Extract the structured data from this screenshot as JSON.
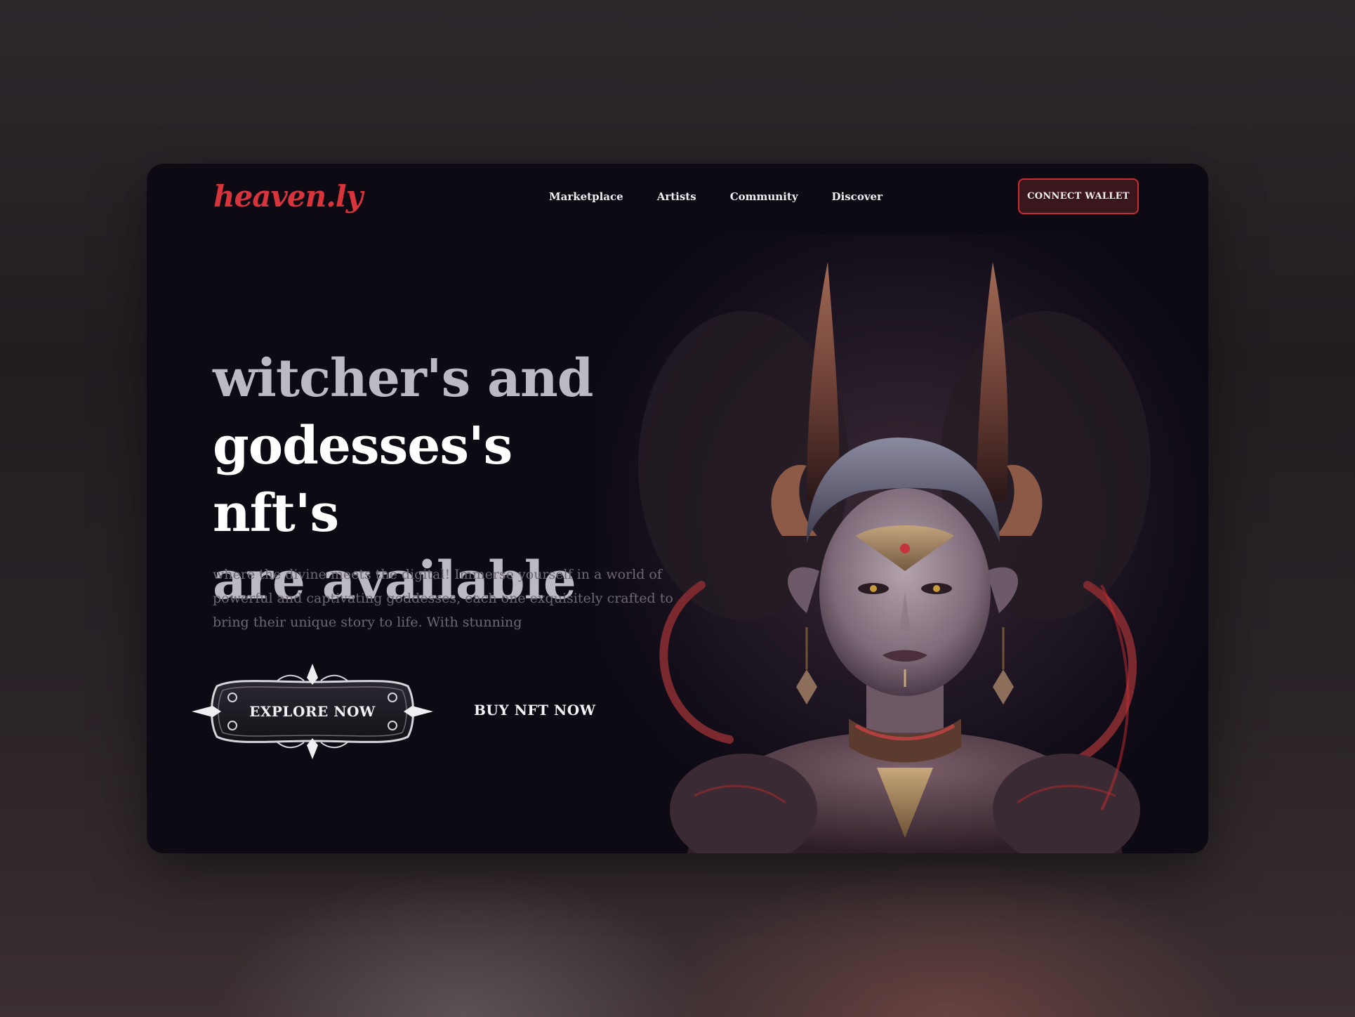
{
  "brand": {
    "logo": "heaven.ly",
    "accent": "#d8343c"
  },
  "nav": {
    "items": [
      {
        "label": "Marketplace"
      },
      {
        "label": "Artists"
      },
      {
        "label": "Community"
      },
      {
        "label": "Discover"
      }
    ]
  },
  "header": {
    "connect_label": "CONNECT WALLET"
  },
  "hero": {
    "headline": [
      "witcher's  and",
      "godesses's  nft's",
      "are  available"
    ],
    "description": "where the divine meets the digital! Immerse yourself in a world of powerful and captivating goddesses, each one exquisitely crafted to bring their unique story to life. With stunning",
    "primary_cta": "EXPLORE NOW",
    "secondary_cta": "BUY NFT NOW"
  },
  "colors": {
    "card_bg": "#0d0a14",
    "button_border": "#c92b33",
    "button_bg": "#3a171d",
    "text_light": "#f1eef2",
    "text_muted": "#6d6873"
  }
}
